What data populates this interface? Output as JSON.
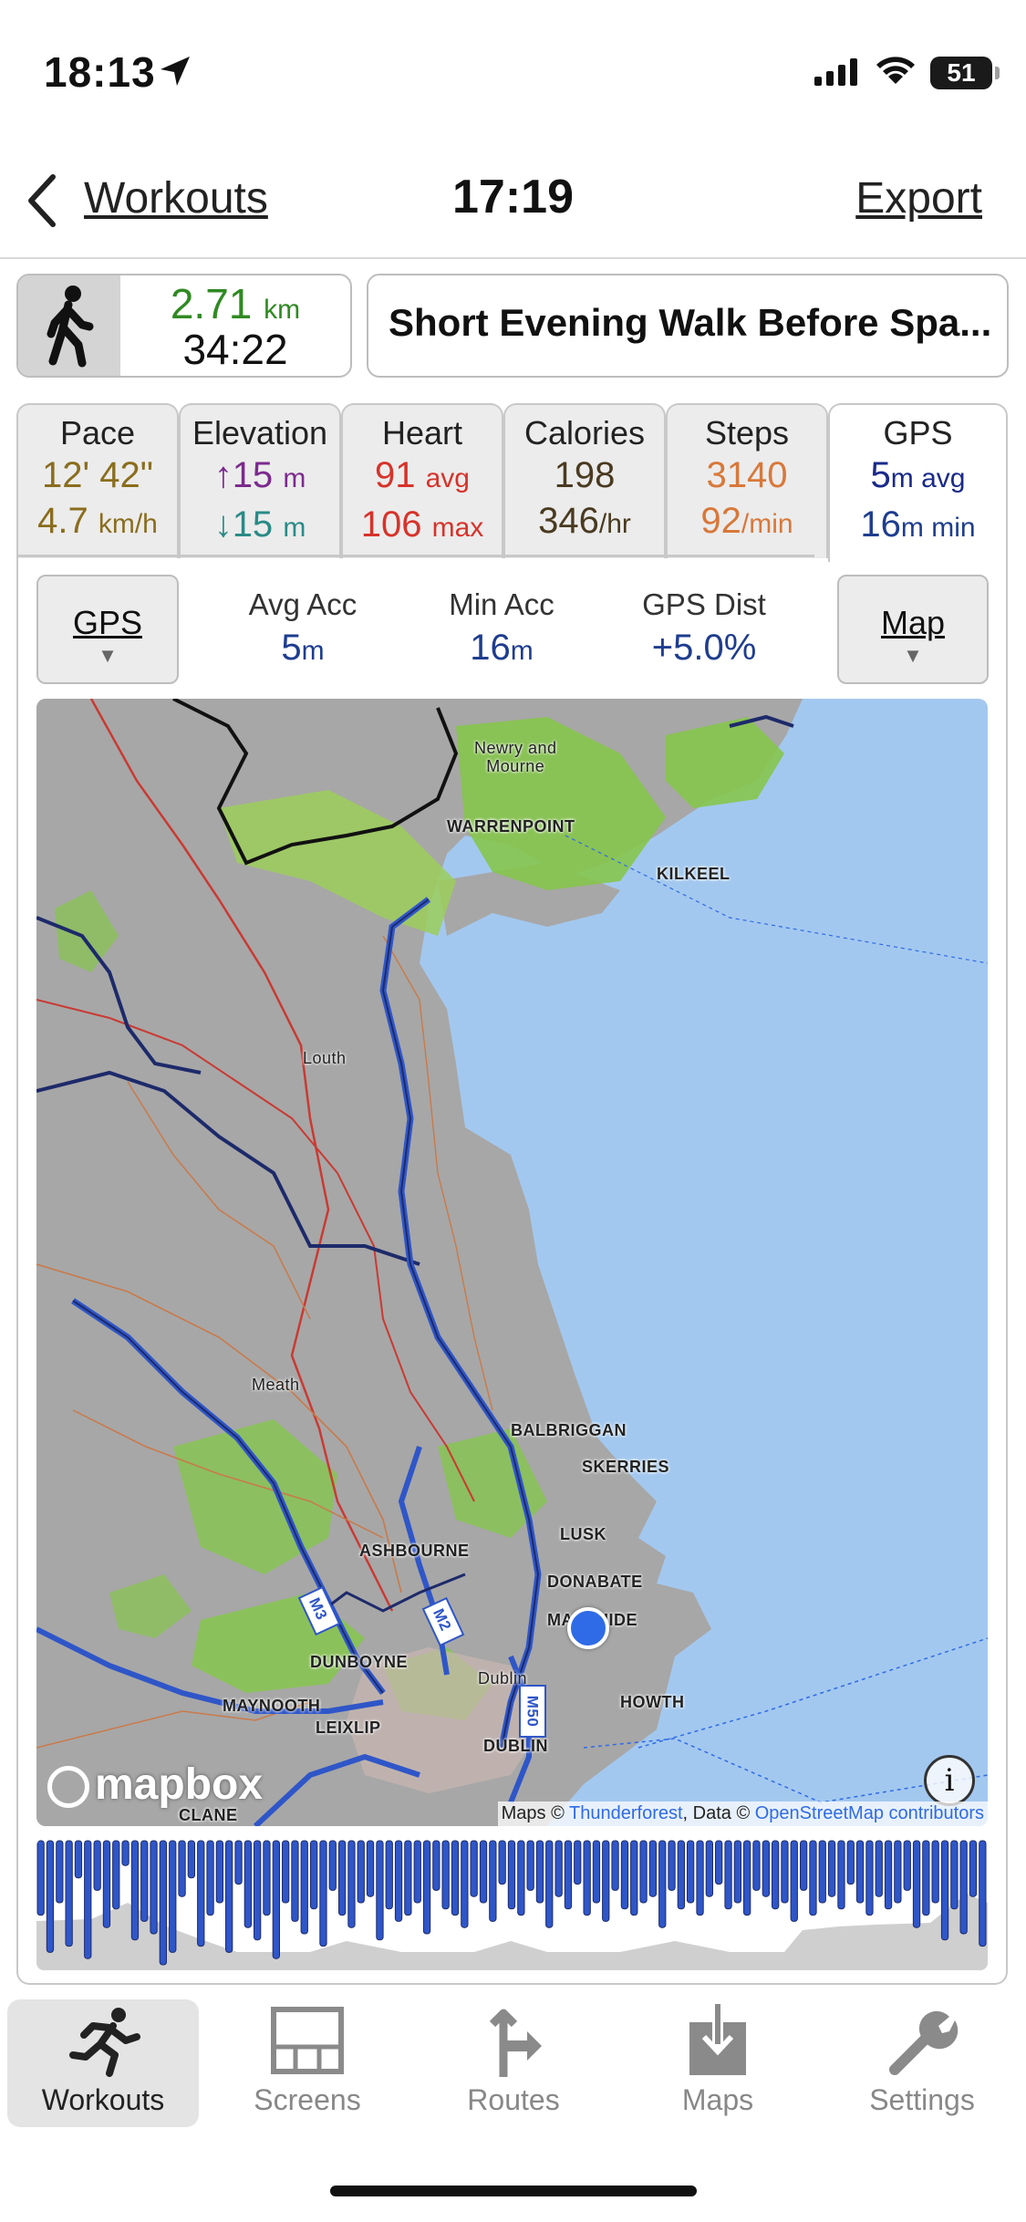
{
  "status_bar": {
    "time": "18:13",
    "battery_level": "51",
    "battery_fraction": 0.51,
    "icons": [
      "location-arrow-icon",
      "cellular-signal-icon",
      "wifi-icon",
      "battery-icon"
    ]
  },
  "nav": {
    "back_label": "Workouts",
    "title": "17:19",
    "export_label": "Export"
  },
  "summary": {
    "activity_icon": "walking-icon",
    "distance": "2.71",
    "distance_unit": "km",
    "duration": "34:22",
    "workout_name": "Short Evening Walk Before Spa..."
  },
  "tabs": {
    "pace": {
      "label": "Pace",
      "line1": "12' 42\"",
      "line2": "4.7",
      "line2_unit": "km/h"
    },
    "elevation": {
      "label": "Elevation",
      "line1": "↑15",
      "line1_unit": "m",
      "line2": "↓15",
      "line2_unit": "m"
    },
    "heart": {
      "label": "Heart",
      "line1": "91",
      "line1_unit": "avg",
      "line2": "106",
      "line2_unit": "max"
    },
    "calories": {
      "label": "Calories",
      "line1": "198",
      "line2": "346",
      "line2_unit": "/hr"
    },
    "steps": {
      "label": "Steps",
      "line1": "3140",
      "line2": "92",
      "line2_unit": "/min"
    },
    "gps": {
      "label": "GPS",
      "line1": "5",
      "line1_unit": "m avg",
      "line2": "16",
      "line2_unit": "m min"
    }
  },
  "panel": {
    "left_selector": "GPS",
    "right_selector": "Map",
    "avg_acc_label": "Avg Acc",
    "avg_acc_value": "5",
    "avg_acc_unit": "m",
    "min_acc_label": "Min Acc",
    "min_acc_value": "16",
    "min_acc_unit": "m",
    "gps_dist_label": "GPS Dist",
    "gps_dist_value": "+5.0%"
  },
  "map": {
    "place_labels": {
      "newry": "Newry and\nMourne",
      "warrenpoint": "WARRENPOINT",
      "kilkeel": "KILKEEL",
      "louth": "Louth",
      "meath": "Meath",
      "balbriggan": "BALBRIGGAN",
      "skerries": "SKERRIES",
      "lusk": "LUSK",
      "ashbourne": "ASHBOURNE",
      "donabate": "DONABATE",
      "malahide": "MALAHIDE",
      "dunboyne": "DUNBOYNE",
      "dublin_county": "Dublin",
      "maynooth": "MAYNOOTH",
      "leixlip": "LEIXLIP",
      "howth": "HOWTH",
      "dublin_city": "DUBLIN",
      "clane": "CLANE"
    },
    "road_labels": {
      "m3": "M3",
      "m2": "M2",
      "m50": "M50"
    },
    "brand": "mapbox",
    "attribution_prefix": "Maps © ",
    "attribution_link1": "Thunderforest",
    "attribution_mid": ", Data © ",
    "attribution_link2": "OpenStreetMap contributors",
    "info_glyph": "i"
  },
  "gps_strip": {
    "accuracy_bars": [
      0.6,
      0.9,
      0.5,
      0.85,
      0.3,
      0.95,
      0.4,
      0.7,
      0.55,
      0.2,
      0.8,
      0.65,
      0.75,
      1.0,
      0.9,
      0.45,
      0.3,
      0.85,
      0.6,
      0.5,
      0.9,
      0.35,
      0.7,
      0.8,
      0.6,
      0.95,
      0.5,
      0.65,
      0.75,
      0.55,
      0.85,
      0.4,
      0.6,
      0.7,
      0.5,
      0.45,
      0.8,
      0.55,
      0.65,
      0.6,
      0.5,
      0.75,
      0.4,
      0.55,
      0.6,
      0.7,
      0.45,
      0.5,
      0.65,
      0.35,
      0.55,
      0.6,
      0.4,
      0.5,
      0.7,
      0.45,
      0.55,
      0.35,
      0.6,
      0.5,
      0.65,
      0.4,
      0.55,
      0.6,
      0.5,
      0.45,
      0.7,
      0.4,
      0.55,
      0.5,
      0.6,
      0.45,
      0.35,
      0.55,
      0.5,
      0.6,
      0.4,
      0.45,
      0.55,
      0.5,
      0.65,
      0.4,
      0.6,
      0.5,
      0.45,
      0.55,
      0.35,
      0.5,
      0.6,
      0.45,
      0.55,
      0.5,
      0.4,
      0.7,
      0.6,
      0.5,
      0.8,
      0.55,
      0.75,
      0.45,
      0.85
    ]
  },
  "tab_bar": {
    "items": [
      {
        "label": "Workouts",
        "icon": "running-person-icon",
        "active": true
      },
      {
        "label": "Screens",
        "icon": "screens-grid-icon",
        "active": false
      },
      {
        "label": "Routes",
        "icon": "route-sign-icon",
        "active": false
      },
      {
        "label": "Maps",
        "icon": "map-download-icon",
        "active": false
      },
      {
        "label": "Settings",
        "icon": "wrench-icon",
        "active": false
      }
    ]
  },
  "colors": {
    "distance_green": "#2f8a22",
    "pace_olive": "#8a6d1e",
    "elevation_purple": "#7b2a8e",
    "elevation_teal": "#2a8a86",
    "heart_red": "#d6332a",
    "calories_brown": "#4a3a20",
    "steps_orange": "#d8783a",
    "gps_navy": "#1a2a8a",
    "stat_blue": "#1e3d8f",
    "sea": "#a3c8ef",
    "land": "#a7a7a7",
    "park": "#86c54d",
    "pin_blue": "#2f6be6"
  }
}
